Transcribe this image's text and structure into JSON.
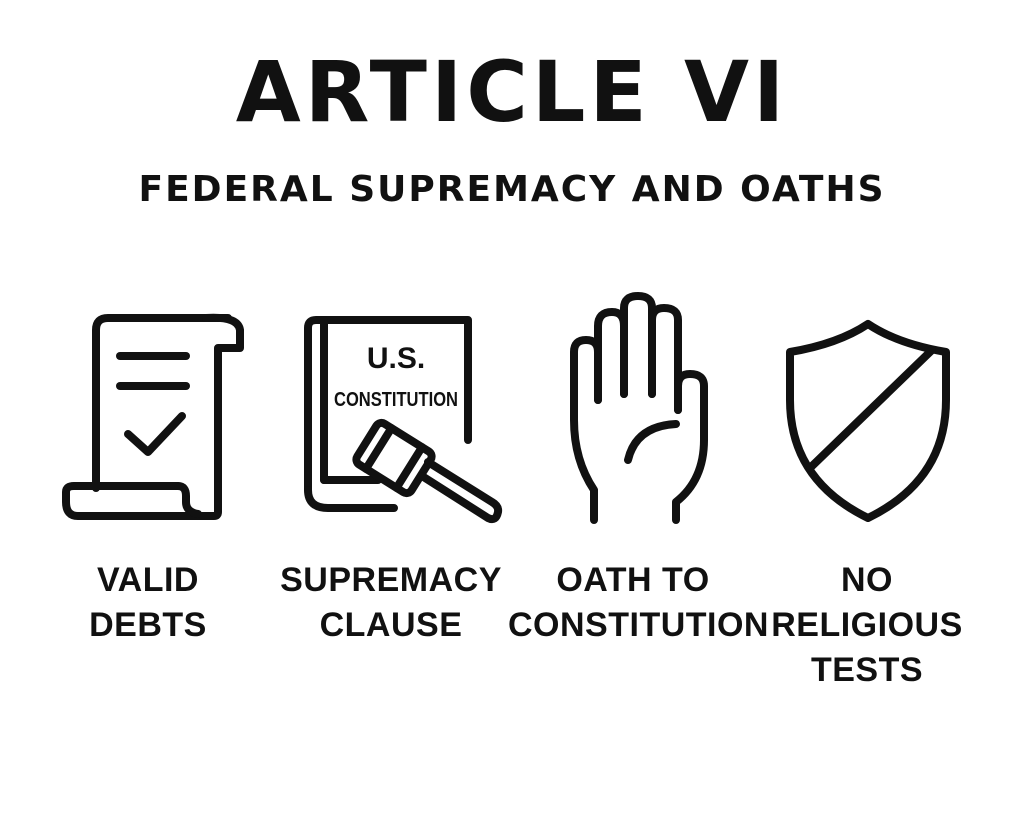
{
  "title": "ARTICLE VI",
  "subtitle": "FEDERAL SUPREMACY AND OATHS",
  "items": [
    {
      "icon": "scroll-checkmark-icon",
      "label_lines": [
        "VALID",
        "DEBTS"
      ]
    },
    {
      "icon": "constitution-book-gavel-icon",
      "book_line1": "U.S.",
      "book_line2": "CONSTITUTION",
      "label_lines": [
        "SUPREMACY",
        "CLAUSE"
      ]
    },
    {
      "icon": "raised-hand-icon",
      "label_lines": [
        "OATH TO",
        "CONSTITUTION"
      ]
    },
    {
      "icon": "shield-icon",
      "label_lines": [
        "NO",
        "RELIGIOUS",
        "TESTS"
      ]
    }
  ]
}
